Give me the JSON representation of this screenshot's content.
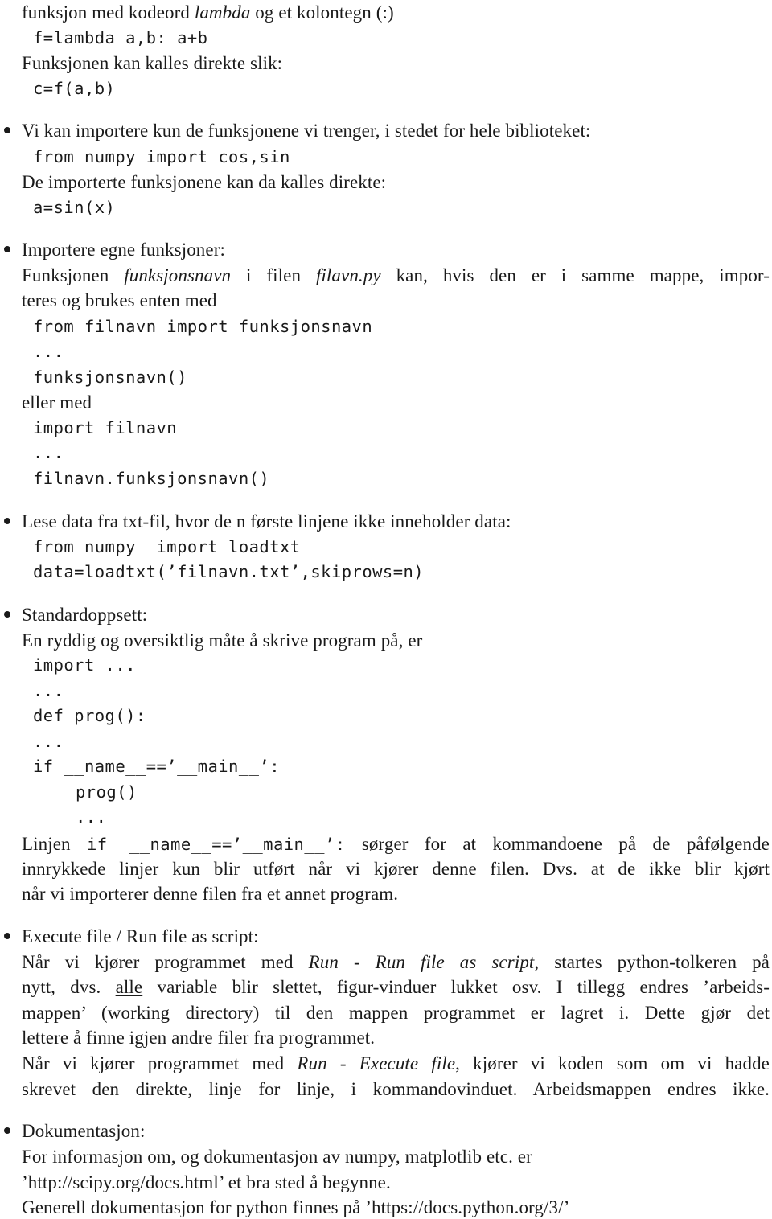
{
  "intro": {
    "line1_prefix": "funksjon med kodeord ",
    "line1_italic": "lambda",
    "line1_suffix": " og et kolontegn (:)",
    "code1": "f=lambda a,b: a+b",
    "line2": "Funksjonen kan kalles direkte slik:",
    "code2": "c=f(a,b)"
  },
  "sections": [
    {
      "title": "Vi kan importere kun de funksjonene vi trenger, i stedet for hele biblioteket:",
      "code1": "from numpy import cos,sin",
      "text1": "De importerte funksjonene kan da kalles direkte:",
      "code2": "a=sin(x)"
    },
    {
      "title": "Importere egne funksjoner:",
      "text1_a": "Funksjonen ",
      "text1_italic1": "funksjonsnavn",
      "text1_b": " i filen ",
      "text1_italic2": "filavn.py",
      "text1_c": " kan, hvis den er i samme mappe, impor-",
      "text2": "teres og brukes enten med",
      "code1": "from filnavn import funksjonsnavn",
      "code2": "...",
      "code3": "funksjonsnavn()",
      "text3": "eller med",
      "code4": "import filnavn",
      "code5": "...",
      "code6": "filnavn.funksjonsnavn()"
    },
    {
      "title": "Lese data fra txt-fil, hvor de n første linjene ikke inneholder data:",
      "code1": "from numpy  import loadtxt",
      "code2": "data=loadtxt(’filnavn.txt’,skiprows=n)"
    },
    {
      "title": "Standardoppsett:",
      "text1": "En ryddig og oversiktlig måte å skrive program på, er",
      "code1": "import ...",
      "code2": "...",
      "code3": "def prog():",
      "code4": "...",
      "code5": "if __name__==’__main__’:",
      "code6": "prog()",
      "code7": "...",
      "text2_a": "Linjen ",
      "text2_code": "if __name__==’__main__’:",
      "text2_b": " sørger for at kommandoene på de påfølgende",
      "text3": "innrykkede linjer kun blir utført når vi kjører denne filen. Dvs. at de ikke blir kjørt",
      "text4": "når vi importerer denne filen fra et annet program."
    },
    {
      "title": "Execute file / Run file as script:",
      "p1_l1_a": "Når vi kjører programmet med ",
      "p1_l1_italic": "Run - Run file as script",
      "p1_l1_b": ", startes python-tolkeren på",
      "p1_l2_a": "nytt, dvs. ",
      "p1_l2_underline": "alle",
      "p1_l2_b": " variable blir slettet, figur-vinduer lukket osv. I tillegg endres ’arbeids-",
      "p1_l3": "mappen’ (working directory) til den mappen programmet er lagret i. Dette gjør det",
      "p1_l4": "lettere å finne igjen andre filer fra programmet.",
      "p2_l1_a": "Når vi kjører programmet med ",
      "p2_l1_italic": "Run - Execute file",
      "p2_l1_b": ", kjører vi koden som om vi hadde",
      "p2_l2": "skrevet den direkte, linje for linje, i kommandovinduet. Arbeidsmappen endres ikke."
    },
    {
      "title": "Dokumentasjon:",
      "l1": "For informasjon om, og dokumentasjon av numpy, matplotlib etc. er",
      "l2": "’http://scipy.org/docs.html’ et bra sted å begynne.",
      "l3": "Generell dokumentasjon for python finnes på ’https://docs.python.org/3/’"
    }
  ]
}
